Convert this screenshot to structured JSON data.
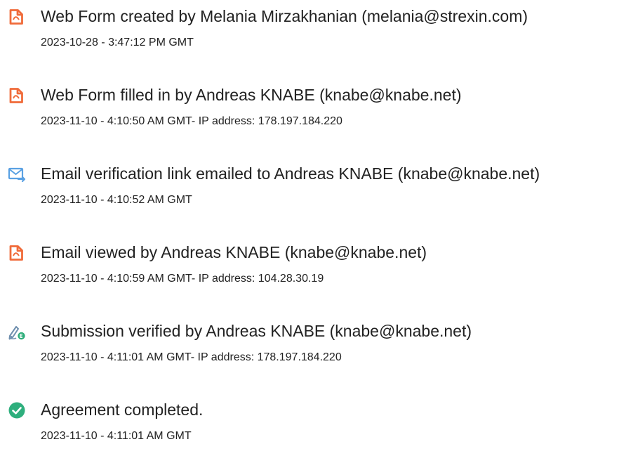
{
  "colors": {
    "document_icon": "#f06b3a",
    "email_icon": "#5aa1e3",
    "verified_icon": "#6f8fae",
    "verified_badge": "#2fae7b",
    "completed_icon": "#2eaf7d",
    "text": "#222222"
  },
  "events": [
    {
      "icon": "pdf-document-icon",
      "title": "Web Form created by Melania Mirzakhanian (melania@strexin.com)",
      "timestamp": "2023-10-28 - 3:47:12 PM GMT"
    },
    {
      "icon": "pdf-document-icon",
      "title": "Web Form filled in by Andreas KNABE (knabe@knabe.net)",
      "timestamp": "2023-11-10 - 4:10:50 AM GMT- IP address: 178.197.184.220"
    },
    {
      "icon": "email-icon",
      "title": "Email verification link emailed to Andreas KNABE (knabe@knabe.net)",
      "timestamp": "2023-11-10 - 4:10:52 AM GMT"
    },
    {
      "icon": "pdf-document-icon",
      "title": "Email viewed by Andreas KNABE (knabe@knabe.net)",
      "timestamp": "2023-11-10 - 4:10:59 AM GMT- IP address: 104.28.30.19"
    },
    {
      "icon": "signature-verified-icon",
      "title": "Submission verified by Andreas KNABE (knabe@knabe.net)",
      "timestamp": "2023-11-10 - 4:11:01 AM GMT- IP address: 178.197.184.220"
    },
    {
      "icon": "check-circle-icon",
      "title": "Agreement completed.",
      "timestamp": "2023-11-10 - 4:11:01 AM GMT"
    }
  ]
}
